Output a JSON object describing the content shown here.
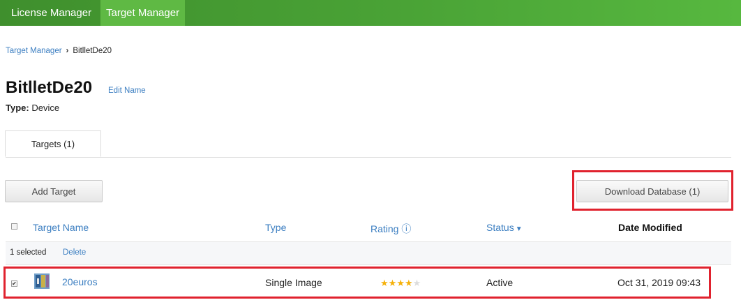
{
  "nav": {
    "license_manager": "License Manager",
    "target_manager": "Target Manager"
  },
  "breadcrumb": {
    "root": "Target Manager",
    "separator": "›",
    "current": "BitlletDe20"
  },
  "database": {
    "name": "BitlletDe20",
    "edit_name": "Edit Name",
    "type_label": "Type:",
    "type_value": "Device"
  },
  "tabs": [
    {
      "label": "Targets (1)"
    }
  ],
  "toolbar": {
    "add_target": "Add Target",
    "download_database": "Download Database (1)"
  },
  "table": {
    "headers": {
      "name": "Target Name",
      "type": "Type",
      "rating": "Rating ⓘ",
      "status": "Status",
      "status_sort_icon": "chevron-down-icon",
      "date": "Date Modified"
    },
    "selection": {
      "count_text": "1 selected",
      "delete": "Delete"
    },
    "rows": [
      {
        "name": "20euros",
        "type": "Single Image",
        "rating": 4,
        "rating_max": 5,
        "status": "Active",
        "date": "Oct 31, 2019 09:43",
        "checked": true
      }
    ]
  },
  "colors": {
    "nav_green": "#4aa336",
    "link_blue": "#3b7ec1",
    "highlight_red": "#e0222e",
    "star_gold": "#f5b10a"
  }
}
